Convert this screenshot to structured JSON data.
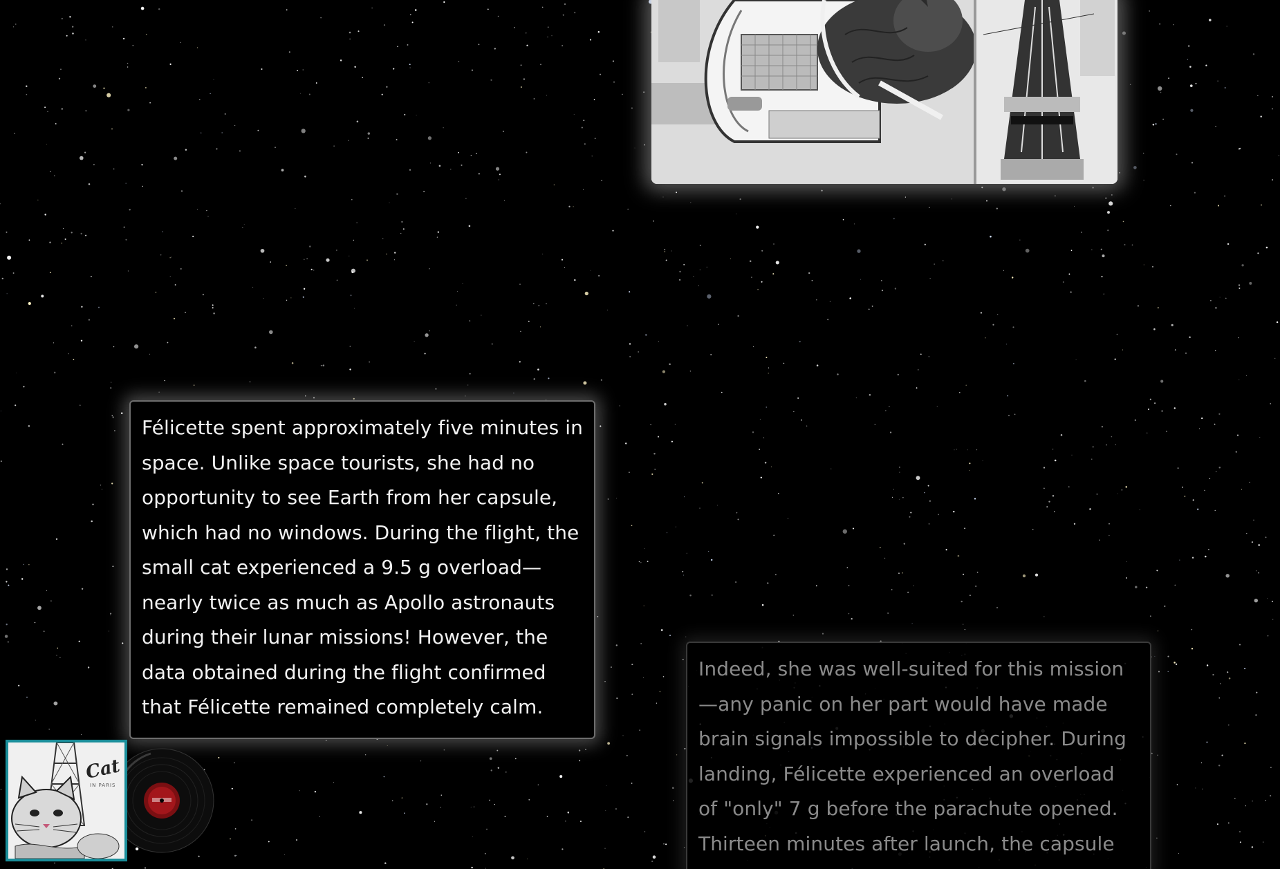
{
  "page": {
    "background_color": "#000000",
    "accent_color": "#1a8e9a"
  },
  "photo": {
    "icon": "capsule-photo-image"
  },
  "cards": {
    "first_text": "Félicette spent approximately five minutes in space. Unlike space tourists, she had no opportunity to see Earth from her capsule, which had no windows. During the flight, the small cat experienced a 9.5 g overload—nearly twice as much as Apollo astronauts during their lunar missions! However, the data obtained during the flight confirmed that Félicette remained completely calm.",
    "second_text": "Indeed, she was well-suited for this mission—any panic on her part would have made brain signals impossible to decipher. During landing, Félicette experienced an overload of \"only\" 7 g before the parachute opened. Thirteen minutes after launch, the capsule safely landed on Earth,"
  },
  "player": {
    "album_title": "Cat",
    "album_subtitle": "IN PARIS",
    "record_icon": "vinyl-record-icon"
  }
}
